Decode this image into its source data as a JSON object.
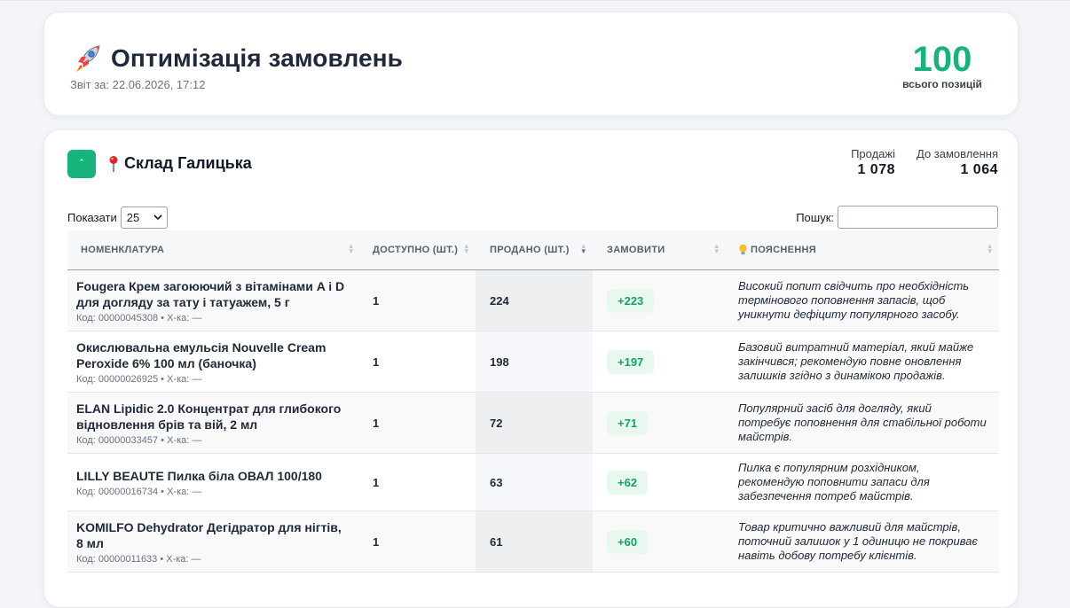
{
  "header": {
    "title": "Оптимізація замовлень",
    "report_date": "Звіт за: 22.06.2026, 17:12",
    "total_value": "100",
    "total_label": "всього позицій",
    "icon": "rocket-icon"
  },
  "store": {
    "collapse_label": "ˆ",
    "name": "Склад Галицька",
    "icon": "map-pin-icon",
    "sales_label": "Продажі",
    "sales_value": "1 078",
    "order_label": "До замовлення",
    "order_value": "1 064"
  },
  "controls": {
    "show_label": "Показати",
    "show_value": "25",
    "search_label": "Пошук:",
    "search_value": ""
  },
  "table": {
    "columns": [
      "НОМЕНКЛАТУРА",
      "ДОСТУПНО (ШТ.)",
      "ПРОДАНО (ШТ.)",
      "ЗАМОВИТИ",
      "ПОЯСНЕННЯ"
    ],
    "rows": [
      {
        "name_line1": "Fougera Крем загоюючий з вітамінами A і D",
        "name_line2": "для догляду за тату і татуажем, 5 г",
        "meta": "Код: 00000045308 • Х-ка: —",
        "available": "1",
        "sold": "224",
        "order": "+223",
        "explanation": [
          "Високий попит свідчить про необхідність",
          "термінового поповнення запасів, щоб",
          "уникнути дефіциту популярного засобу."
        ]
      },
      {
        "name_line1": "Окислювальна емульсія Nouvelle Cream",
        "name_line2": "Peroxide 6% 100 мл (баночка)",
        "meta": "Код: 00000026925 • Х-ка: —",
        "available": "1",
        "sold": "198",
        "order": "+197",
        "explanation": [
          "Базовий витратний матеріал, який майже",
          "закінчився; рекомендую повне оновлення",
          "залишків згідно з динамікою продажів."
        ]
      },
      {
        "name_line1": "ELAN Lipidic 2.0 Концентрат для глибокого",
        "name_line2": "відновлення брів та вій, 2 мл",
        "meta": "Код: 00000033457 • Х-ка: —",
        "available": "1",
        "sold": "72",
        "order": "+71",
        "explanation": [
          "Популярний засіб для догляду, який",
          "потребує поповнення для стабільної роботи",
          "майстрів."
        ]
      },
      {
        "name_line1": "LILLY BEAUTE Пилка біла ОВАЛ 100/180",
        "name_line2": "",
        "meta": "Код: 00000016734 • Х-ка: —",
        "available": "1",
        "sold": "63",
        "order": "+62",
        "explanation": [
          "Пилка є популярним розхідником,",
          "рекомендую поповнити запаси для",
          "забезпечення потреб майстрів."
        ]
      },
      {
        "name_line1": "KOMILFO Dehydrator Дегідратор для нігтів,",
        "name_line2": "8 мл",
        "meta": "Код: 00000011633 • Х-ка: —",
        "available": "1",
        "sold": "61",
        "order": "+60",
        "explanation": [
          "Товар критично важливий для майстрів,",
          "поточний залишок у 1 одиницю не покриває",
          "навіть добову потребу клієнтів."
        ]
      }
    ]
  },
  "colors": {
    "accent": "#16b37a",
    "badge_bg": "#e8f8ef",
    "badge_text": "#16a06a"
  }
}
